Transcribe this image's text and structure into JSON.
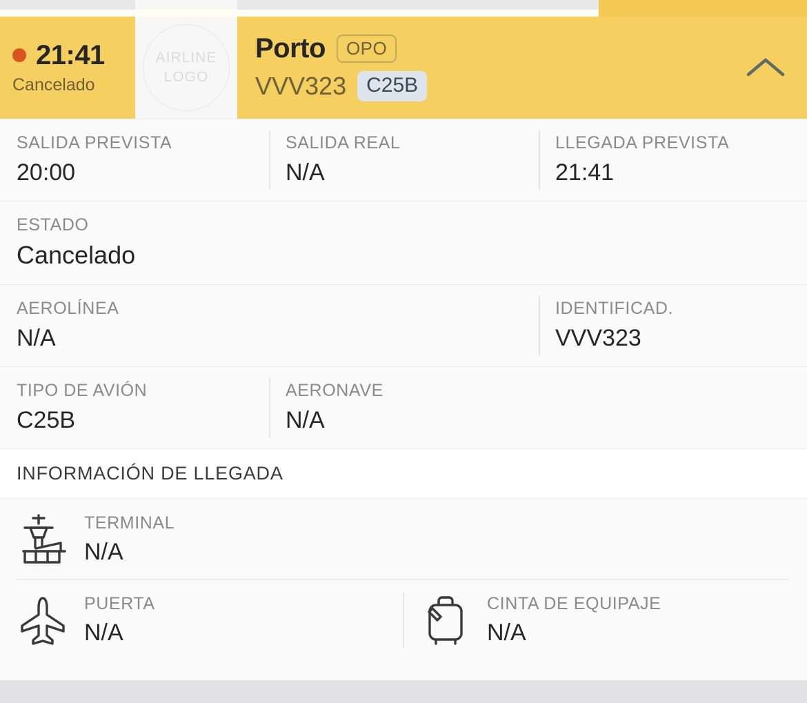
{
  "header": {
    "time": "21:41",
    "status_short": "Cancelado",
    "status_dot_color": "#d9541e",
    "logo_placeholder_line1": "AIRLINE",
    "logo_placeholder_line2": "LOGO",
    "destination_city": "Porto",
    "destination_iata": "OPO",
    "flight_ident": "VVV323",
    "aircraft_badge": "C25B",
    "toggle_icon": "chevron-up-icon",
    "background_color": "#f5cf5f",
    "badge_color": "#dde4ec"
  },
  "rows": {
    "times": [
      {
        "label": "SALIDA PREVISTA",
        "value": "20:00"
      },
      {
        "label": "SALIDA REAL",
        "value": "N/A"
      },
      {
        "label": "LLEGADA PREVISTA",
        "value": "21:41"
      }
    ],
    "estado": {
      "label": "ESTADO",
      "value": "Cancelado"
    },
    "airline": [
      {
        "label": "AEROLÍNEA",
        "value": "N/A"
      },
      {
        "label": "IDENTIFICAD.",
        "value": "VVV323"
      }
    ],
    "aircraft": [
      {
        "label": "TIPO DE AVIÓN",
        "value": "C25B"
      },
      {
        "label": "AERONAVE",
        "value": "N/A"
      }
    ]
  },
  "arrival_section": {
    "title": "INFORMACIÓN DE LLEGADA",
    "terminal": {
      "icon": "control-tower-icon",
      "label": "TERMINAL",
      "value": "N/A"
    },
    "gate": {
      "icon": "airplane-icon",
      "label": "PUERTA",
      "value": "N/A"
    },
    "baggage": {
      "icon": "suitcase-icon",
      "label": "CINTA DE EQUIPAJE",
      "value": "N/A"
    }
  }
}
